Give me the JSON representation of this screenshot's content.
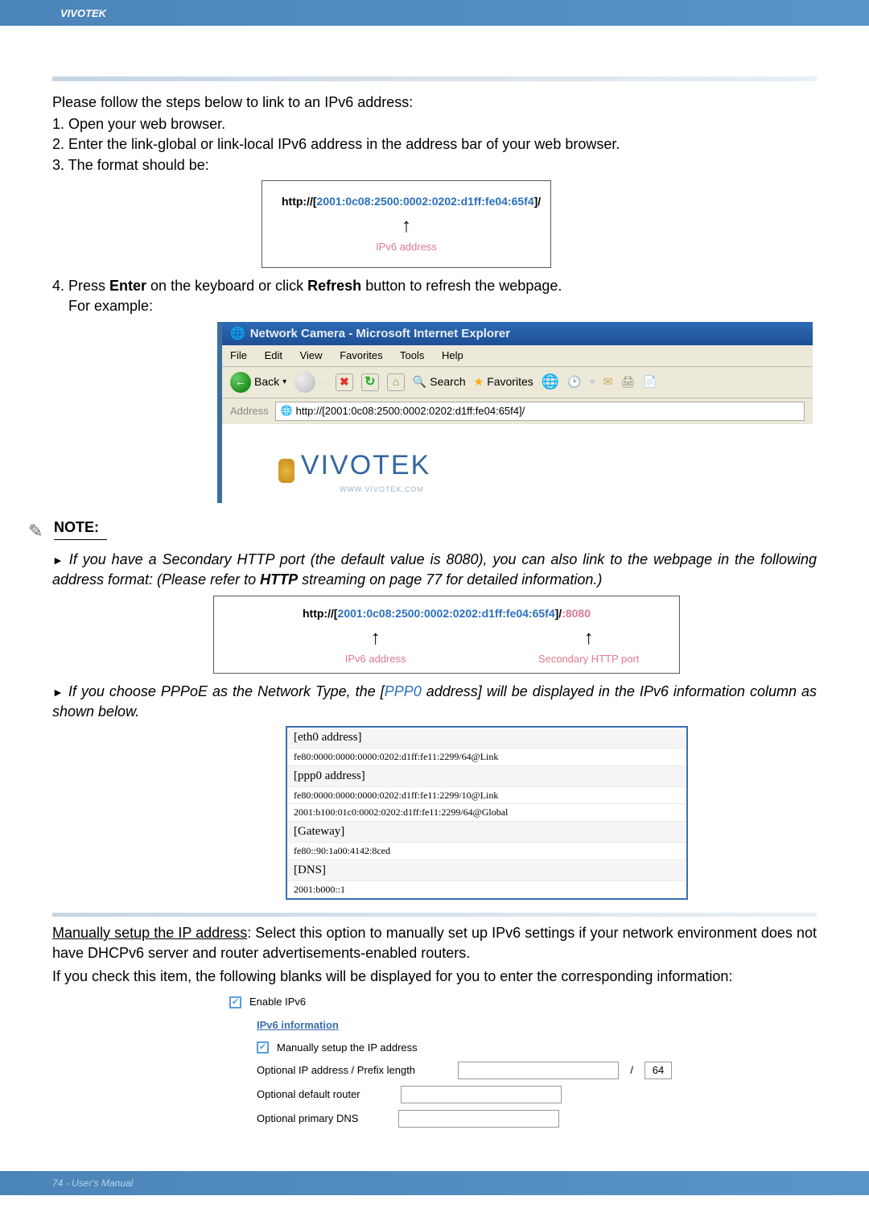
{
  "header": {
    "brand": "VIVOTEK"
  },
  "intro": "Please follow the steps below to link to an IPv6 address:",
  "steps": {
    "s1": "1. Open your web browser.",
    "s2": "2. Enter the link-global or link-local IPv6 address in the address bar of your web browser.",
    "s3": "3. The format should be:",
    "s4a": "4. Press ",
    "s4b": "Enter",
    "s4c": " on the keyboard or click ",
    "s4d": "Refresh",
    "s4e": " button to refresh the webpage.",
    "eg": "For example:"
  },
  "url_box1": {
    "prefix": "http://",
    "bracket_open": "[",
    "addr": "2001:0c08:2500:0002:0202:d1ff:fe04:65f4",
    "bracket_close": "]",
    "suffix": "/",
    "label": "IPv6 address"
  },
  "ie": {
    "title": "Network Camera - Microsoft Internet Explorer",
    "menu": {
      "file": "File",
      "edit": "Edit",
      "view": "View",
      "fav": "Favorites",
      "tools": "Tools",
      "help": "Help"
    },
    "toolbar": {
      "back": "Back",
      "search": "Search",
      "favorites": "Favorites"
    },
    "address_label": "Address",
    "address_value": "http://[2001:0c08:2500:0002:0202:d1ff:fe04:65f4]/",
    "logo": "VIVOTEK",
    "logo_sub": "WWW.VIVOTEK.COM"
  },
  "note": {
    "label": "NOTE:",
    "item1_a": "If you have a Secondary HTTP port (the default value is 8080), you can also link to the webpage in the following address format: (Please refer to ",
    "item1_b": "HTTP",
    "item1_c": " streaming on page 77 for detailed information.)",
    "item2_a": "If you choose PPPoE as the Network Type, the [",
    "item2_b": "PPP0",
    "item2_c": " address] will be displayed in the IPv6 information column as shown below."
  },
  "url_box2": {
    "prefix": "http://",
    "bracket_open": "[",
    "addr": "2001:0c08:2500:0002:0202:d1ff:fe04:65f4",
    "bracket_close": "]",
    "suffix": "/",
    "colon": ":",
    "port": "8080",
    "label_left": "IPv6 address",
    "label_right": "Secondary HTTP port"
  },
  "ipv6_info": {
    "eth0": "[eth0 address]",
    "eth0_val": "fe80:0000:0000:0000:0202:d1ff:fe11:2299/64@Link",
    "ppp0": "[ppp0 address]",
    "ppp0_val1": "fe80:0000:0000:0000:0202:d1ff:fe11:2299/10@Link",
    "ppp0_val2": "2001:b100:01c0:0002:0202:d1ff:fe11:2299/64@Global",
    "gateway": "[Gateway]",
    "gateway_val": "fe80::90:1a00:4142:8ced",
    "dns": "[DNS]",
    "dns_val": "2001:b000::1"
  },
  "para1_a": "Manually setup the IP address",
  "para1_b": ": Select this option to manually set up IPv6 settings if your network environment does not have DHCPv6 server and router advertisements-enabled routers.",
  "para2": "If you check this item, the following blanks will be displayed for you to enter the corresponding information:",
  "form": {
    "enable": "Enable IPv6",
    "section": "IPv6 information",
    "manual": "Manually setup the IP address",
    "opt_ip": "Optional IP address / Prefix length",
    "prefix_val": "64",
    "opt_router": "Optional default router",
    "opt_dns": "Optional primary DNS"
  },
  "footer": {
    "text": "74 - User's Manual"
  }
}
